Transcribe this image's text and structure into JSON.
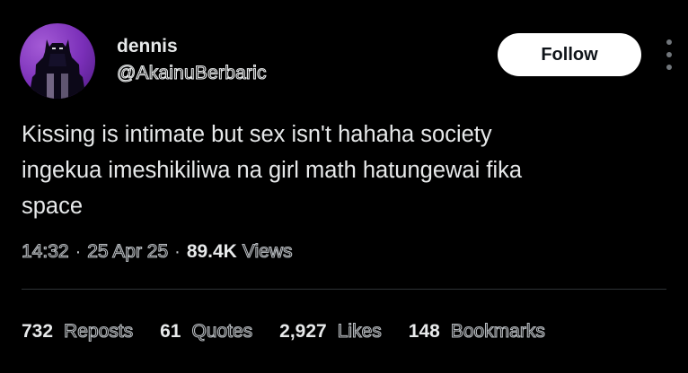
{
  "author": {
    "display_name": "dennis",
    "handle": "@AkainuBerbaric",
    "avatar_icon": "batman-silhouette-icon"
  },
  "actions": {
    "follow_label": "Follow",
    "more_icon": "vertical-ellipsis-icon"
  },
  "tweet": {
    "text": "Kissing is intimate but sex isn't hahaha society\ningekua imeshikiliwa na girl math hatungewai fika\nspace"
  },
  "meta": {
    "time": "14:32",
    "date": "25 Apr 25",
    "separator": "·",
    "views_count": "89.4K",
    "views_label": "Views"
  },
  "stats": [
    {
      "count": "732",
      "label": "Reposts"
    },
    {
      "count": "61",
      "label": "Quotes"
    },
    {
      "count": "2,927",
      "label": "Likes"
    },
    {
      "count": "148",
      "label": "Bookmarks"
    }
  ],
  "colors": {
    "background": "#000000",
    "text": "#e7e9ea",
    "secondary": "#71767b",
    "follow_bg": "#ffffff",
    "avatar_bg": "#7a2fb8"
  }
}
